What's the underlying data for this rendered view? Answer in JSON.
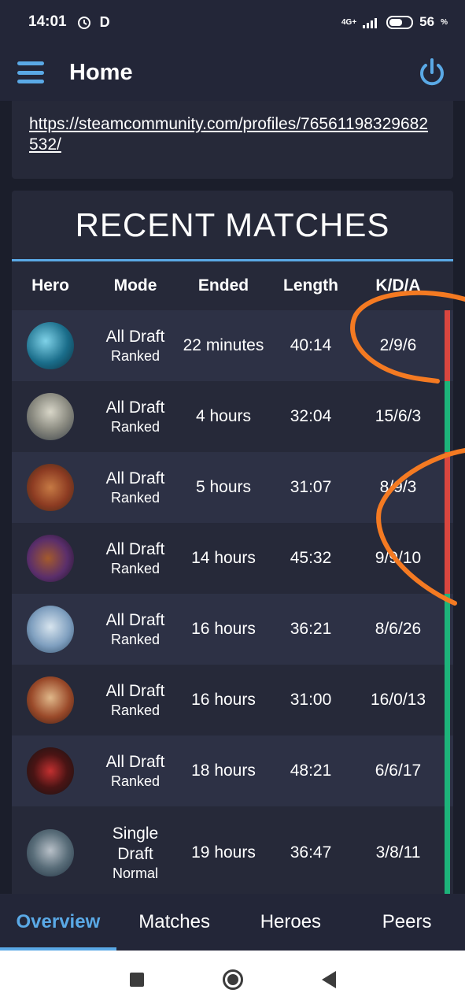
{
  "status_bar": {
    "time": "14:01",
    "carrier_icon": "D",
    "network": "4G+",
    "battery": "56",
    "battery_unit": "%"
  },
  "app_bar": {
    "title": "Home"
  },
  "profile": {
    "link": "https://steamcommunity.com/profiles/76561198329682532/"
  },
  "recent_matches": {
    "title": "RECENT MATCHES",
    "headers": [
      "Hero",
      "Mode",
      "Ended",
      "Length",
      "K/D/A"
    ],
    "rows": [
      {
        "hero_icon": "hero-morphling-icon",
        "mode": "All Draft",
        "type": "Ranked",
        "ended": "22 minutes",
        "length": "40:14",
        "kda": "2/9/6",
        "result": "loss"
      },
      {
        "hero_icon": "hero-clockwerk-icon",
        "mode": "All Draft",
        "type": "Ranked",
        "ended": "4 hours",
        "length": "32:04",
        "kda": "15/6/3",
        "result": "win"
      },
      {
        "hero_icon": "hero-monkey-king-icon",
        "mode": "All Draft",
        "type": "Ranked",
        "ended": "5 hours",
        "length": "31:07",
        "kda": "8/9/3",
        "result": "loss"
      },
      {
        "hero_icon": "hero-faceless-void-icon",
        "mode": "All Draft",
        "type": "Ranked",
        "ended": "14 hours",
        "length": "45:32",
        "kda": "9/9/10",
        "result": "loss"
      },
      {
        "hero_icon": "hero-zeus-icon",
        "mode": "All Draft",
        "type": "Ranked",
        "ended": "16 hours",
        "length": "36:21",
        "kda": "8/6/26",
        "result": "win"
      },
      {
        "hero_icon": "hero-juggernaut-icon",
        "mode": "All Draft",
        "type": "Ranked",
        "ended": "16 hours",
        "length": "31:00",
        "kda": "16/0/13",
        "result": "win"
      },
      {
        "hero_icon": "hero-shadow-fiend-icon",
        "mode": "All Draft",
        "type": "Ranked",
        "ended": "18 hours",
        "length": "48:21",
        "kda": "6/6/17",
        "result": "win"
      },
      {
        "hero_icon": "hero-tiny-icon",
        "mode": "Single Draft",
        "type": "Normal",
        "ended": "19 hours",
        "length": "36:47",
        "kda": "3/8/11",
        "result": "win"
      }
    ]
  },
  "tabs": [
    "Overview",
    "Matches",
    "Heroes",
    "Peers"
  ],
  "colors": {
    "accent": "#5aa9e6",
    "win": "#1db37a",
    "loss": "#d9463f",
    "annotation": "#f47a22"
  }
}
